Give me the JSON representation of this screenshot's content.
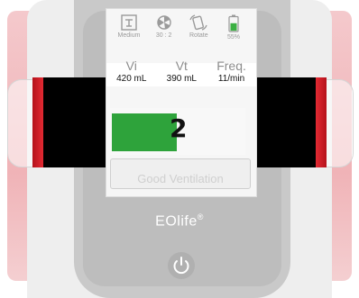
{
  "status": {
    "items": [
      {
        "icon": "mask-size-icon",
        "label": "Medium"
      },
      {
        "icon": "ratio-fan-icon",
        "label": "30 : 2"
      },
      {
        "icon": "rotate-icon",
        "label": "Rotate"
      },
      {
        "icon": "battery-icon",
        "label": "55%"
      }
    ],
    "battery_level": 0.55,
    "battery_color": "#3cb043"
  },
  "metrics": [
    {
      "label": "Vi",
      "value": "420 mL"
    },
    {
      "label": "Vt",
      "value": "390 mL"
    },
    {
      "label": "Freq.",
      "value": "11/min"
    }
  ],
  "breath": {
    "count": "2",
    "fill_fraction": 0.49,
    "bar_color": "#2ea33b"
  },
  "ventilation_status": "Good Ventilation",
  "brand": {
    "name": "EOlife",
    "mark": "®"
  },
  "colors": {
    "accent_red": "#e32a33"
  }
}
